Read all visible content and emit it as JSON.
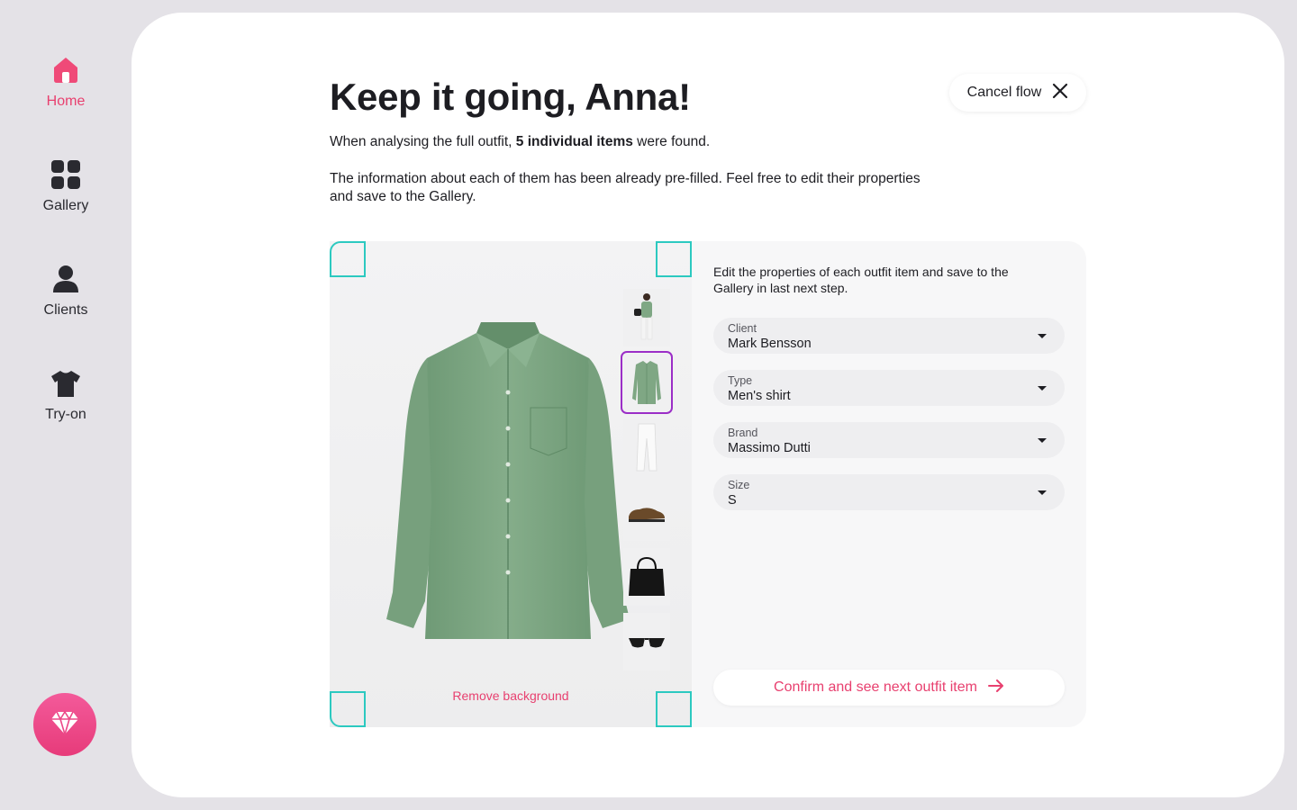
{
  "sidebar": {
    "items": [
      {
        "label": "Home",
        "icon": "home-icon",
        "active": true
      },
      {
        "label": "Gallery",
        "icon": "grid-icon"
      },
      {
        "label": "Clients",
        "icon": "person-icon"
      },
      {
        "label": "Try-on",
        "icon": "tshirt-icon"
      }
    ],
    "premium_icon": "diamond-icon"
  },
  "header": {
    "title": "Keep it going, Anna!",
    "line1_prefix": "When analysing the full outfit, ",
    "line1_bold": "5 individual items",
    "line1_suffix": " were found.",
    "line2": "The information about each of them has been already pre-filled. Feel free to edit their properties and save to the Gallery.",
    "cancel_label": "Cancel flow"
  },
  "image_panel": {
    "remove_background_label": "Remove background",
    "thumbnails": [
      {
        "item": "full-outfit"
      },
      {
        "item": "green-shirt",
        "selected": true
      },
      {
        "item": "white-trousers"
      },
      {
        "item": "brown-shoes"
      },
      {
        "item": "black-bag"
      },
      {
        "item": "sunglasses"
      }
    ]
  },
  "form": {
    "intro": "Edit the properties of each outfit item and save to the Gallery in last next step.",
    "fields": [
      {
        "label": "Client",
        "value": "Mark Bensson"
      },
      {
        "label": "Type",
        "value": "Men's shirt"
      },
      {
        "label": "Brand",
        "value": "Massimo Dutti"
      },
      {
        "label": "Size",
        "value": "S"
      }
    ],
    "confirm_label": "Confirm and see next outfit item"
  },
  "colors": {
    "accent": "#e8406f",
    "selection": "#9b2ec7",
    "frame_corner": "#2cc9c0",
    "shirt": "#7fa784"
  }
}
